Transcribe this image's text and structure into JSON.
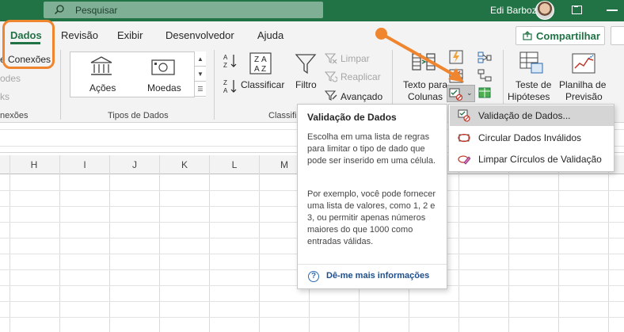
{
  "titlebar": {
    "search_placeholder": "Pesquisar",
    "user_name": "Edi Barboza"
  },
  "tabs": [
    {
      "label": "Dados",
      "active": true
    },
    {
      "label": "Revisão"
    },
    {
      "label": "Exibir"
    },
    {
      "label": "Desenvolvedor"
    },
    {
      "label": "Ajuda"
    }
  ],
  "share_label": "Compartilhar",
  "ribbon": {
    "connections": {
      "item1": "e Conexões",
      "item2": "odes",
      "item3": "ks",
      "group_label": "nexões"
    },
    "data_types": {
      "item1": "Ações",
      "item2": "Moedas",
      "group_label": "Tipos de Dados"
    },
    "sort_filter": {
      "classify": "Classificar",
      "filter": "Filtro",
      "clear": "Limpar",
      "reapply": "Reaplicar",
      "advanced": "Avançado",
      "group_label": "Classifi"
    },
    "data_tools": {
      "text_to_columns_line1": "Texto para",
      "text_to_columns_line2": "Colunas"
    },
    "forecast": {
      "whatif_line1": "Teste de",
      "whatif_line2": "Hipóteses",
      "sheet_line1": "Planilha de",
      "sheet_line2": "Previsão"
    }
  },
  "columns": [
    "H",
    "I",
    "J",
    "K",
    "L",
    "M"
  ],
  "tooltip": {
    "title": "Validação de Dados",
    "body1": "Escolha em uma lista de regras para limitar o tipo de dado que pode ser inserido em uma célula.",
    "body2": "Por exemplo, você pode fornecer uma lista de valores, como 1, 2 e 3, ou permitir apenas números maiores do que 1000 como entradas válidas.",
    "help": "Dê-me mais informações"
  },
  "menu": {
    "items": [
      {
        "label": "Validação de Dados...",
        "hover": true
      },
      {
        "label": "Circular Dados Inválidos"
      },
      {
        "label": "Limpar Círculos de Validação"
      }
    ]
  },
  "colors": {
    "excel_green": "#217346",
    "annotation_orange": "#f0852f"
  }
}
